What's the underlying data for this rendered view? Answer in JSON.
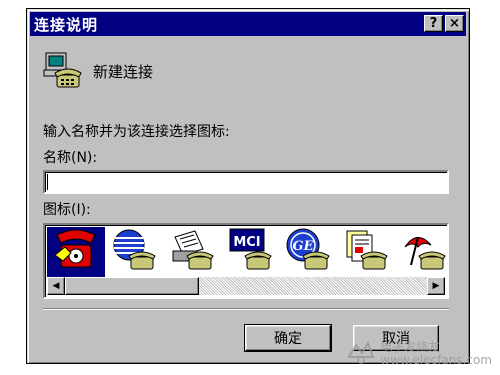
{
  "window": {
    "title": "连接说明",
    "help_button": "?",
    "close_button": "×"
  },
  "header": {
    "label": "新建连接",
    "icon": "dialup-modem-phone-icon"
  },
  "form": {
    "prompt": "输入名称并为该连接选择图标:",
    "name_label": "名称(N):",
    "name_value": "",
    "icon_label": "图标(I):"
  },
  "icons": [
    {
      "name": "red-phone-icon",
      "selected": true
    },
    {
      "name": "globe-phone-icon",
      "selected": false
    },
    {
      "name": "fax-phone-icon",
      "selected": false
    },
    {
      "name": "mci-phone-icon",
      "label": "MCI",
      "selected": false
    },
    {
      "name": "ge-phone-icon",
      "label": "GE",
      "selected": false
    },
    {
      "name": "documents-phone-icon",
      "selected": false
    },
    {
      "name": "umbrella-phone-icon",
      "selected": false
    }
  ],
  "buttons": {
    "ok": "确定",
    "cancel": "取消"
  },
  "watermark": {
    "line1": "电子发烧友",
    "line2": "www.elecfans.com"
  },
  "colors": {
    "titlebar": "#000080",
    "face": "#c0c0c0",
    "selection": "#000080"
  }
}
